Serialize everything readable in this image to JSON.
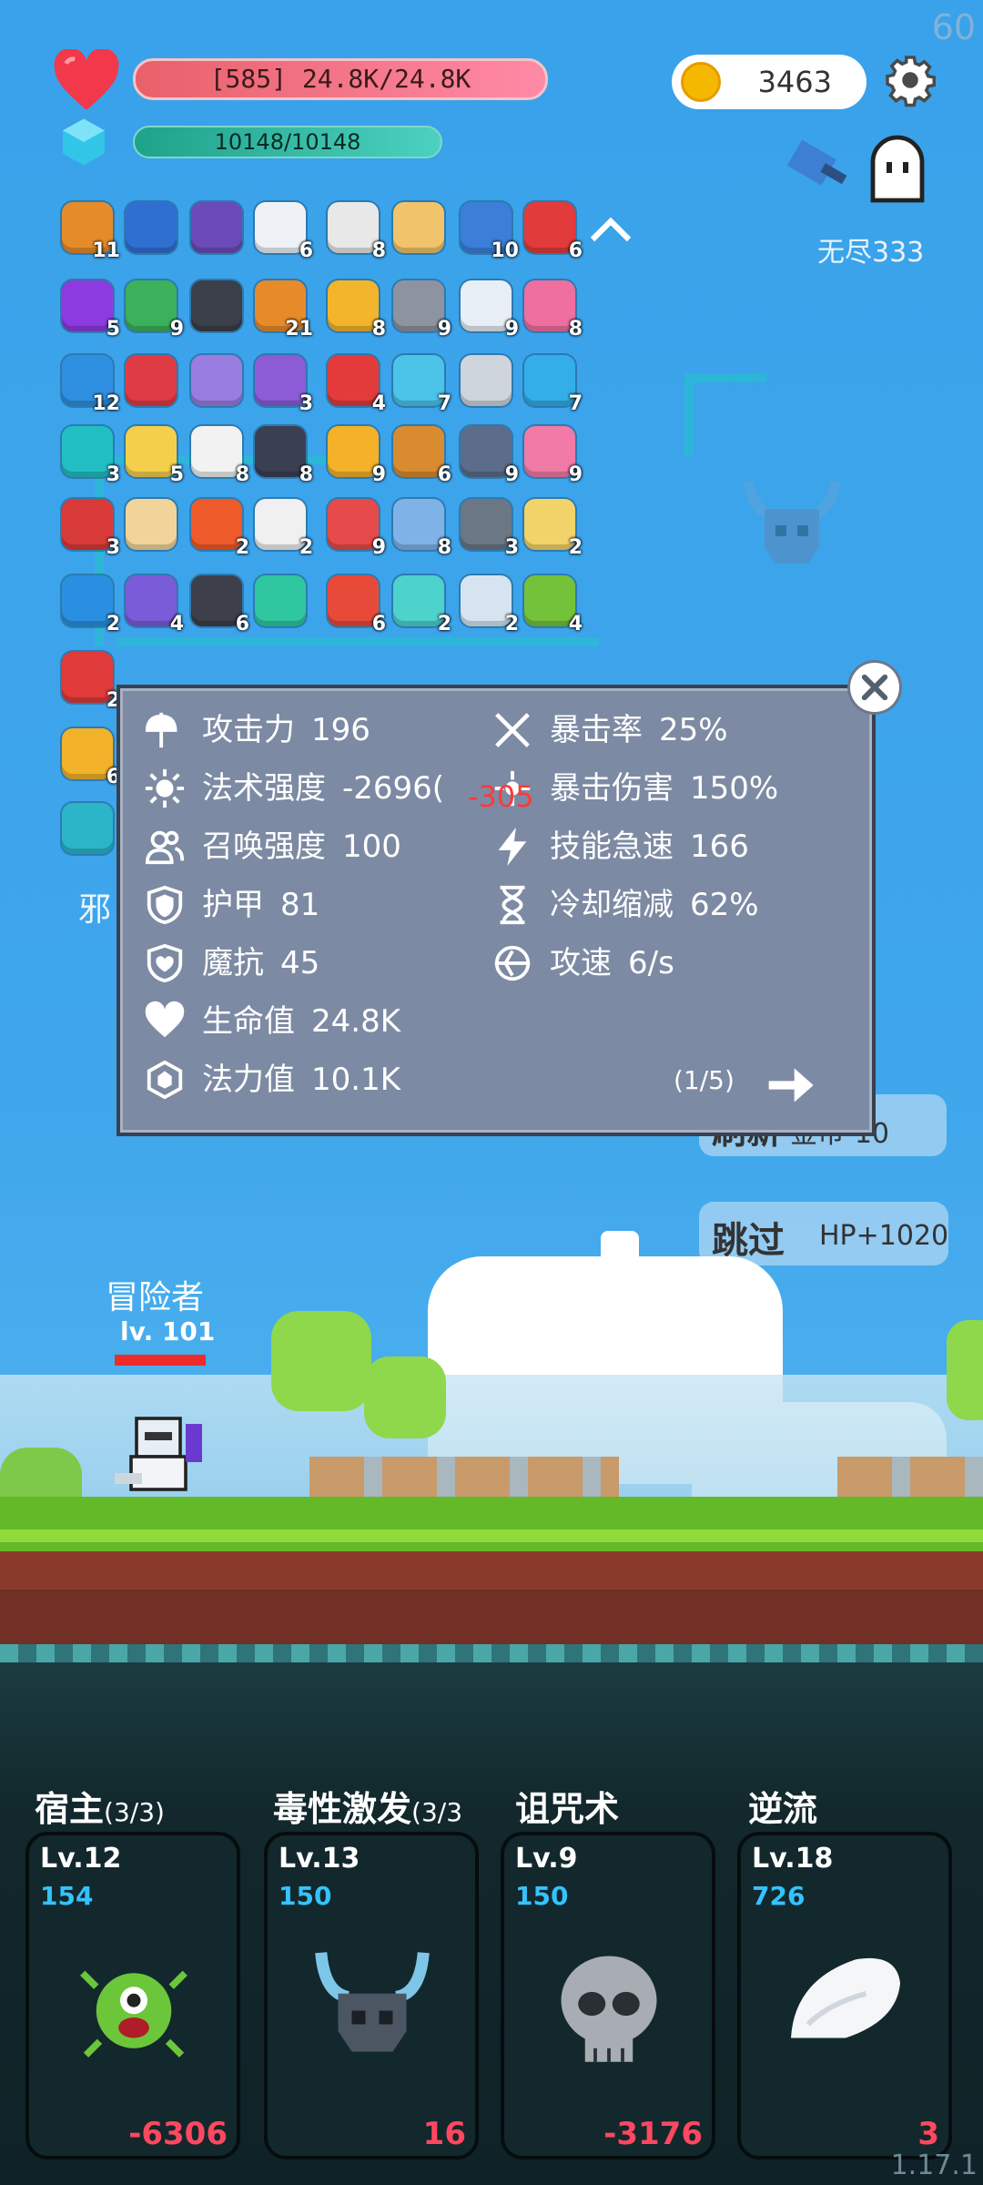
{
  "hud": {
    "hp_text": "[585] 24.8K/24.8K",
    "mp_text": "10148/10148",
    "gold": "3463",
    "endless_label": "无尽333",
    "fps": "60"
  },
  "items": [
    {
      "icon": "book",
      "color": "#e58c2a",
      "count": "11"
    },
    {
      "icon": "cards",
      "color": "#2f6fd2",
      "count": ""
    },
    {
      "icon": "wizard-hat",
      "color": "#6a4bb8",
      "count": ""
    },
    {
      "icon": "envelope",
      "color": "#eef2f7",
      "count": "6"
    },
    {
      "icon": "playing-cards",
      "color": "#e8e8e8",
      "count": "8"
    },
    {
      "icon": "scroll",
      "color": "#f1c36a",
      "count": ""
    },
    {
      "icon": "shield",
      "color": "#3b7fd8",
      "count": "10"
    },
    {
      "icon": "sock",
      "color": "#e23b3b",
      "count": "6"
    },
    {
      "icon": "crystal-ball",
      "color": "#8b3be0",
      "count": "5"
    },
    {
      "icon": "money",
      "color": "#3cb05a",
      "count": "9"
    },
    {
      "icon": "hood",
      "color": "#3b3f4a",
      "count": ""
    },
    {
      "icon": "briefcase",
      "color": "#e78a2a",
      "count": "21"
    },
    {
      "icon": "egg",
      "color": "#f2b52c",
      "count": "8"
    },
    {
      "icon": "spiked-ball",
      "color": "#8d93a0",
      "count": "9"
    },
    {
      "icon": "clipboard",
      "color": "#e7eef5",
      "count": "9"
    },
    {
      "icon": "spray-bottle",
      "color": "#ef6fa0",
      "count": "8"
    },
    {
      "icon": "star-card",
      "color": "#2f8fe0",
      "count": "12"
    },
    {
      "icon": "red-shield",
      "color": "#df3b45",
      "count": ""
    },
    {
      "icon": "horn",
      "color": "#9a7de0",
      "count": ""
    },
    {
      "icon": "purple-badge",
      "color": "#8b5cd6",
      "count": "3"
    },
    {
      "icon": "heat-waves",
      "color": "#e33b3b",
      "count": "4"
    },
    {
      "icon": "potion",
      "color": "#4cc3e8",
      "count": "7"
    },
    {
      "icon": "hook",
      "color": "#cfd5dc",
      "count": ""
    },
    {
      "icon": "chat-bubble",
      "color": "#33aee8",
      "count": "7"
    },
    {
      "icon": "target-square",
      "color": "#21bfc3",
      "count": "3"
    },
    {
      "icon": "note",
      "color": "#f4cf4b",
      "count": "5"
    },
    {
      "icon": "dice",
      "color": "#f2f2f2",
      "count": "8"
    },
    {
      "icon": "dark-book",
      "color": "#3a3f52",
      "count": "8"
    },
    {
      "icon": "sun",
      "color": "#f5b12a",
      "count": "9"
    },
    {
      "icon": "bow",
      "color": "#d98b2f",
      "count": "6"
    },
    {
      "icon": "dagger",
      "color": "#5b6d8a",
      "count": "9"
    },
    {
      "icon": "ice-cream",
      "color": "#f27aa6",
      "count": "9"
    },
    {
      "icon": "small-shield",
      "color": "#d83a3a",
      "count": "3"
    },
    {
      "icon": "map",
      "color": "#f1d49a",
      "count": ""
    },
    {
      "icon": "fire-ring",
      "color": "#ef5a2a",
      "count": "2"
    },
    {
      "icon": "compass",
      "color": "#f0f0f0",
      "count": "2"
    },
    {
      "icon": "thermometer",
      "color": "#e74a4a",
      "count": "9"
    },
    {
      "icon": "robe",
      "color": "#7fb3e8",
      "count": "8"
    },
    {
      "icon": "tree",
      "color": "#6b7785",
      "count": "3"
    },
    {
      "icon": "halo",
      "color": "#f2d36a",
      "count": "2"
    },
    {
      "icon": "gem",
      "color": "#2a8fe0",
      "count": "2"
    },
    {
      "icon": "treasure-box",
      "color": "#7a5bd8",
      "count": "4"
    },
    {
      "icon": "bat",
      "color": "#3d3f4a",
      "count": "6"
    },
    {
      "icon": "lamp",
      "color": "#2ec7a0",
      "count": ""
    },
    {
      "icon": "map-pin",
      "color": "#e84a3a",
      "count": "6"
    },
    {
      "icon": "ring-disc",
      "color": "#4dd2cc",
      "count": "2"
    },
    {
      "icon": "bulb",
      "color": "#d5e4f0",
      "count": "2"
    },
    {
      "icon": "lime",
      "color": "#74c23a",
      "count": "4"
    },
    {
      "icon": "percent-tag",
      "color": "#e03a3a",
      "count": "2"
    },
    {
      "icon": "pineapple",
      "color": "#f2b22a",
      "count": "6"
    },
    {
      "icon": "bright-card",
      "color": "#2ab6c8",
      "count": ""
    }
  ],
  "side_label": "邪",
  "stats": {
    "left": [
      {
        "icon": "axe-icon",
        "label": "攻击力",
        "value": "196"
      },
      {
        "icon": "sun-icon",
        "label": "法术强度",
        "value": "-2696("
      },
      {
        "icon": "people-icon",
        "label": "召唤强度",
        "value": "100"
      },
      {
        "icon": "shield-icon",
        "label": "护甲",
        "value": "81"
      },
      {
        "icon": "heart-shield-icon",
        "label": "魔抗",
        "value": "45"
      },
      {
        "icon": "heart-icon",
        "label": "生命值",
        "value": "24.8K"
      },
      {
        "icon": "gem-icon",
        "label": "法力值",
        "value": "10.1K"
      }
    ],
    "right": [
      {
        "icon": "crossed-swords-icon",
        "label": "暴击率",
        "value": "25%"
      },
      {
        "icon": "burst-icon",
        "label": "暴击伤害",
        "value": "150%"
      },
      {
        "icon": "lightning-icon",
        "label": "技能急速",
        "value": "166"
      },
      {
        "icon": "hourglass-icon",
        "label": "冷却缩减",
        "value": "62%"
      },
      {
        "icon": "bow-target-icon",
        "label": "攻速",
        "value": "6/s"
      }
    ],
    "overlap_text": "-305",
    "page": "(1/5)"
  },
  "chips": {
    "refresh_label": "刷新",
    "refresh_cost": "金币-10",
    "skip_label": "跳过",
    "skip_bonus": "HP+1020"
  },
  "player": {
    "name": "冒险者",
    "level": "lv. 101",
    "hp_fraction": 1.0
  },
  "skills": [
    {
      "name": "宿主",
      "suffix": "(3/3)",
      "level": "Lv.12",
      "value": "154",
      "damage": "-6306",
      "icon": "monster-icon"
    },
    {
      "name": "毒性激发",
      "suffix": "(3/3",
      "level": "Lv.13",
      "value": "150",
      "damage": "16",
      "icon": "viking-helmet-icon"
    },
    {
      "name": "诅咒术",
      "suffix": "",
      "level": "Lv.9",
      "value": "150",
      "damage": "-3176",
      "icon": "skull-icon"
    },
    {
      "name": "逆流",
      "suffix": "",
      "level": "Lv.18",
      "value": "726",
      "damage": "3",
      "icon": "wing-icon"
    }
  ],
  "version": "1.17.1"
}
